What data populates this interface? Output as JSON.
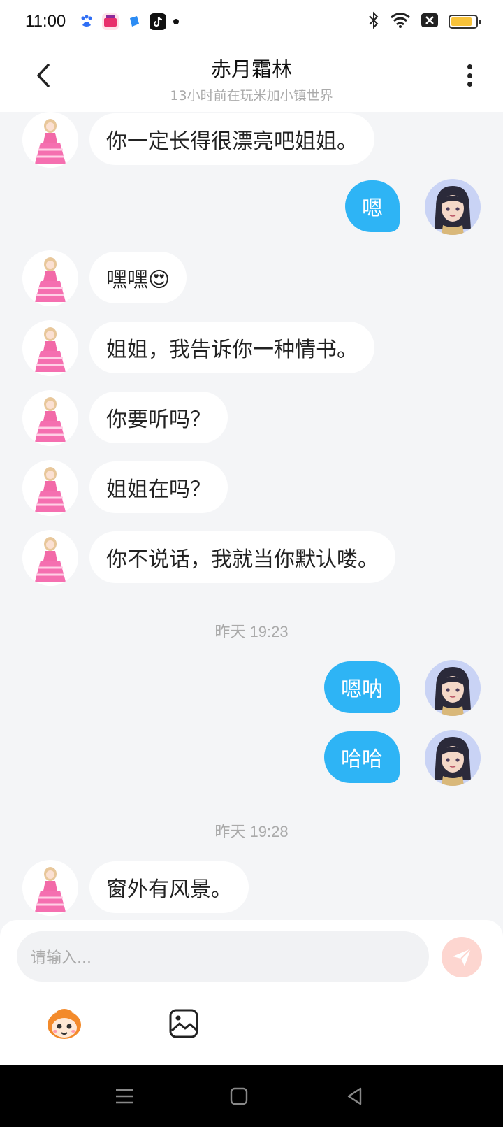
{
  "status_bar": {
    "time": "11:00",
    "apps": [
      "baidu-icon",
      "video-app-icon",
      "blue-app-icon",
      "tiktok-icon"
    ],
    "battery_level": 0.85,
    "battery_color": "#f7c23a"
  },
  "header": {
    "title": "赤月霜林",
    "subtitle": "13小时前在玩米加小镇世界"
  },
  "messages": [
    {
      "side": "left",
      "text": "你一定长得很漂亮吧姐姐。"
    },
    {
      "side": "right",
      "text": "嗯"
    },
    {
      "side": "left",
      "text": "嘿嘿😍"
    },
    {
      "side": "left",
      "text": "姐姐，我告诉你一种情书。"
    },
    {
      "side": "left",
      "text": "你要听吗？"
    },
    {
      "side": "left",
      "text": "姐姐在吗？"
    },
    {
      "side": "left",
      "text": "你不说话，我就当你默认喽。"
    },
    {
      "type": "time",
      "text": "昨天 19:23"
    },
    {
      "side": "right",
      "text": "嗯呐"
    },
    {
      "side": "right",
      "text": "哈哈"
    },
    {
      "type": "time",
      "text": "昨天 19:28"
    },
    {
      "side": "left",
      "text": "窗外有风景。"
    }
  ],
  "input": {
    "placeholder": "请输入..."
  },
  "colors": {
    "accent": "#2eb4f5",
    "send_button": "#fdd6d0",
    "background": "#f4f5f7"
  }
}
